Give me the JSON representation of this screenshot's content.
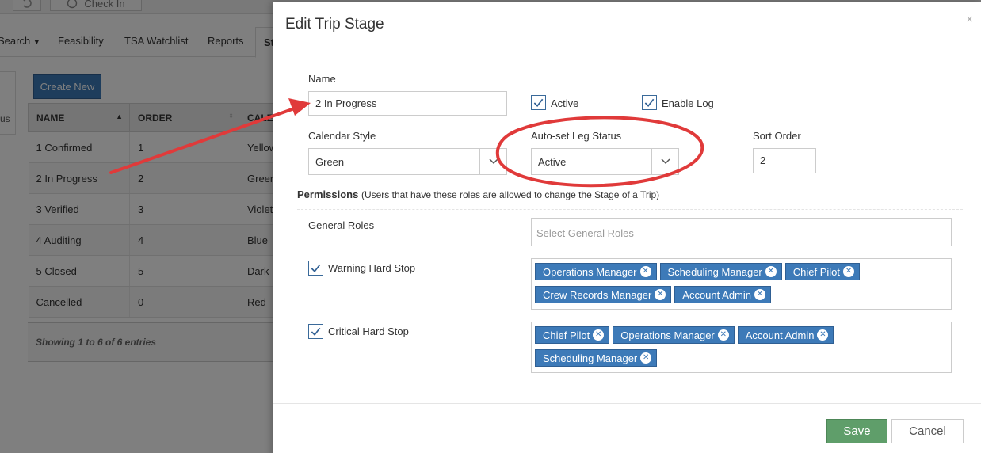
{
  "background": {
    "toolbar": {
      "checkin_label": "Check In"
    },
    "nav": {
      "items": [
        "Search",
        "Feasibility",
        "TSA Watchlist",
        "Reports"
      ],
      "active_partial": "St"
    },
    "sidepane_text": "us",
    "create_button": "Create New",
    "table": {
      "headers": [
        "NAME",
        "ORDER",
        "CALE"
      ],
      "rows": [
        [
          "1 Confirmed",
          "1",
          "Yellow"
        ],
        [
          "2 In Progress",
          "2",
          "Green"
        ],
        [
          "3 Verified",
          "3",
          "Violet"
        ],
        [
          "4 Auditing",
          "4",
          "Blue"
        ],
        [
          "5 Closed",
          "5",
          "Dark"
        ],
        [
          "Cancelled",
          "0",
          "Red"
        ]
      ],
      "footer": "Showing 1 to 6 of 6 entries"
    }
  },
  "modal": {
    "title": "Edit Trip Stage",
    "close_glyph": "×",
    "name_label": "Name",
    "name_value": "2 In Progress",
    "active_label": "Active",
    "active_checked": true,
    "enable_log_label": "Enable Log",
    "enable_log_checked": true,
    "calendar_style_label": "Calendar Style",
    "calendar_style_value": "Green",
    "auto_leg_label": "Auto-set Leg Status",
    "auto_leg_value": "Active",
    "sort_order_label": "Sort Order",
    "sort_order_value": "2",
    "permissions_title": "Permissions",
    "permissions_sub": "(Users that have these roles are allowed to change the Stage of a Trip)",
    "general_roles_label": "General Roles",
    "general_roles_placeholder": "Select General Roles",
    "warning_label": "Warning Hard Stop",
    "warning_checked": true,
    "warning_roles": [
      "Operations Manager",
      "Scheduling Manager",
      "Chief Pilot",
      "Crew Records Manager",
      "Account Admin"
    ],
    "critical_label": "Critical Hard Stop",
    "critical_checked": true,
    "critical_roles": [
      "Chief Pilot",
      "Operations Manager",
      "Account Admin",
      "Scheduling Manager"
    ],
    "save_label": "Save",
    "cancel_label": "Cancel"
  },
  "colors": {
    "primary_blue": "#3d7ab8",
    "save_green": "#5f9e6a",
    "annotation_red": "#e03a3a"
  }
}
